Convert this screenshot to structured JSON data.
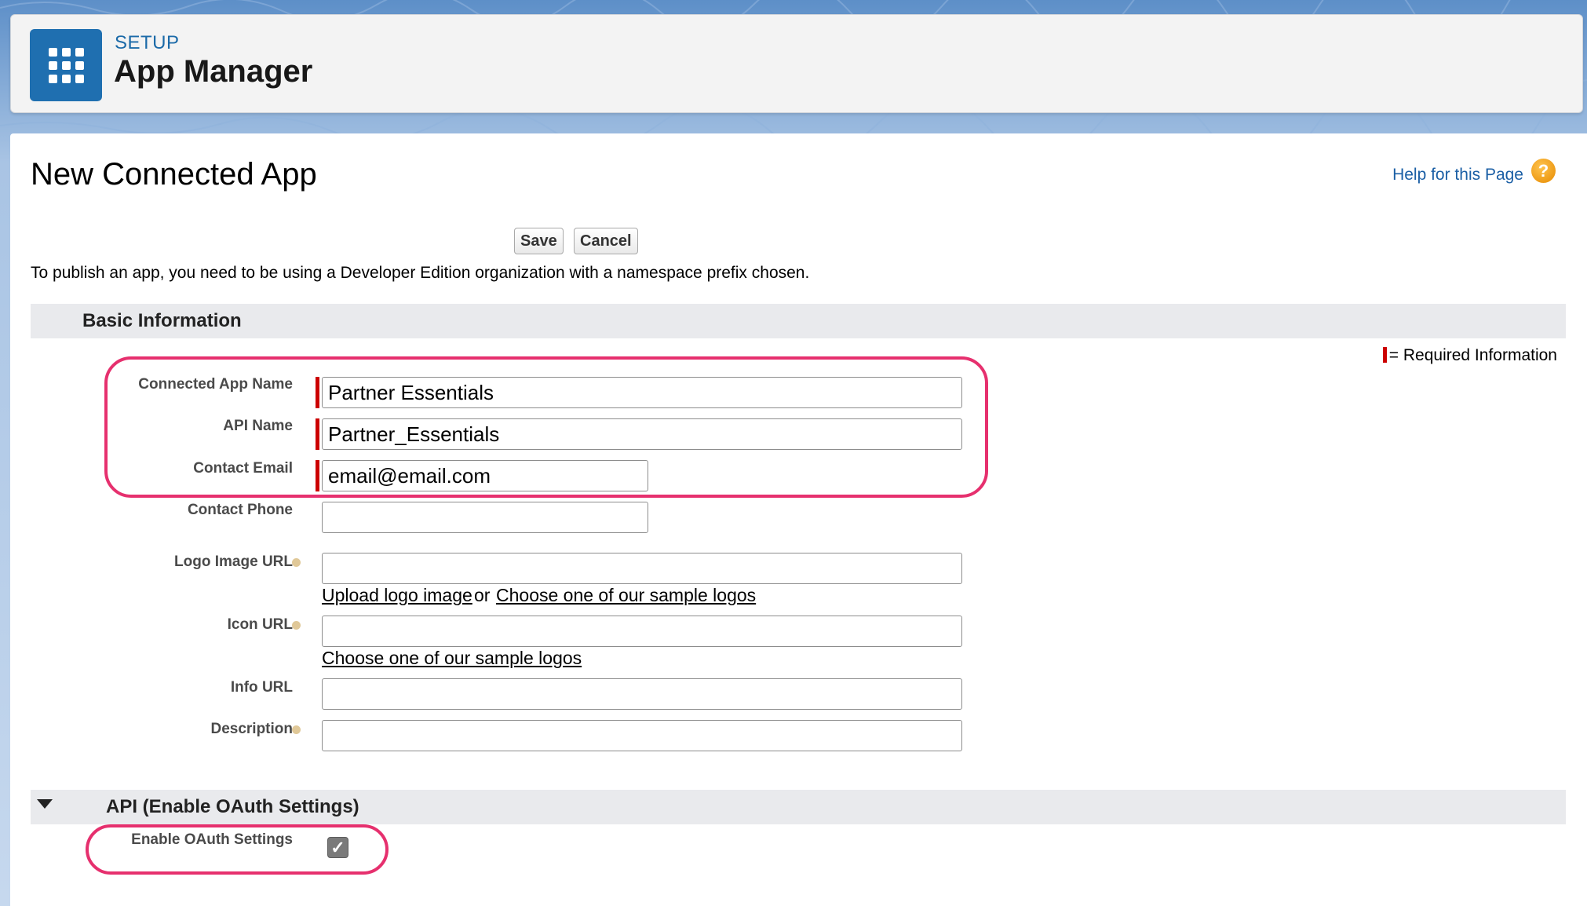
{
  "header": {
    "eyebrow": "SETUP",
    "title": "App Manager",
    "icon": "app-launcher-grid-icon"
  },
  "page": {
    "title": "New Connected App",
    "help_link": "Help for this Page",
    "help_icon_glyph": "?"
  },
  "toolbar": {
    "save_label": "Save",
    "cancel_label": "Cancel"
  },
  "publish_note": "To publish an app, you need to be using a Developer Edition organization with a namespace prefix chosen.",
  "basic_info": {
    "section_title": "Basic Information",
    "required_note": "= Required Information",
    "fields": {
      "connected_app_name": {
        "label": "Connected App Name",
        "value": "Partner Essentials"
      },
      "api_name": {
        "label": "API Name",
        "value": "Partner_Essentials"
      },
      "contact_email": {
        "label": "Contact Email",
        "value": "email@email.com"
      },
      "contact_phone": {
        "label": "Contact Phone",
        "value": ""
      },
      "logo_image_url": {
        "label": "Logo Image URL",
        "value": "",
        "upload_link": "Upload logo image",
        "or_text": "or",
        "sample_link": "Choose one of our sample logos"
      },
      "icon_url": {
        "label": "Icon URL",
        "value": "",
        "sample_link": "Choose one of our sample logos"
      },
      "info_url": {
        "label": "Info URL",
        "value": ""
      },
      "description": {
        "label": "Description",
        "value": ""
      }
    }
  },
  "api_section": {
    "section_title": "API (Enable OAuth Settings)",
    "enable_oauth": {
      "label": "Enable OAuth Settings",
      "checked": true,
      "check_glyph": "✓"
    }
  },
  "colors": {
    "brand_blue": "#1f6fb0",
    "highlight_pink": "#e6306e",
    "required_red": "#cc0000",
    "link_blue": "#1b5fa5"
  }
}
